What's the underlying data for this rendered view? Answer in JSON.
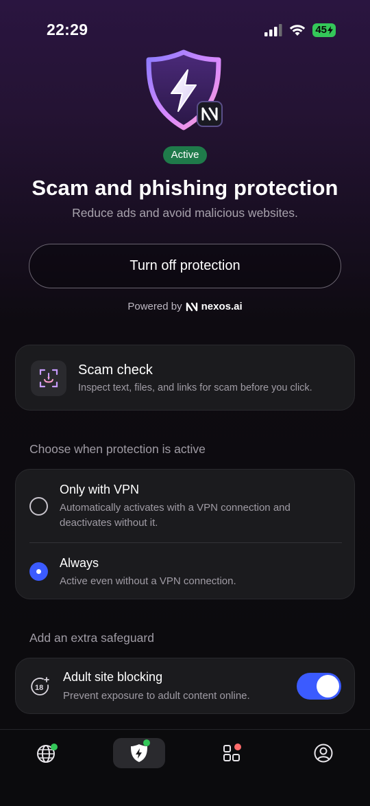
{
  "status_bar": {
    "time": "22:29",
    "battery": "45"
  },
  "hero": {
    "badge": "Active",
    "title": "Scam and phishing protection",
    "subtitle": "Reduce ads and avoid malicious websites.",
    "primary_button": "Turn off protection",
    "powered_by_prefix": "Powered by",
    "powered_by_brand": "nexos.ai"
  },
  "scam_check": {
    "title": "Scam check",
    "description": "Inspect text, files, and links for scam before you click.",
    "icon": "scan-face-icon"
  },
  "protection_mode": {
    "section_label": "Choose when protection is active",
    "options": [
      {
        "title": "Only with VPN",
        "description": "Automatically activates with a VPN connection and deactivates without it.",
        "selected": false
      },
      {
        "title": "Always",
        "description": "Active even without a VPN connection.",
        "selected": true
      }
    ]
  },
  "extra_safeguard": {
    "section_label": "Add an extra safeguard",
    "title": "Adult site blocking",
    "description": "Prevent exposure to adult content online.",
    "icon_text": "18",
    "enabled": true
  },
  "tab_bar": {
    "tabs": [
      {
        "icon": "globe-icon",
        "badge_color": "#34c759",
        "active": false
      },
      {
        "icon": "shield-bolt-icon",
        "badge_color": "#34c759",
        "active": true
      },
      {
        "icon": "apps-grid-icon",
        "badge_color": "#ff6b6b",
        "active": false
      },
      {
        "icon": "profile-icon",
        "badge_color": "",
        "active": false
      }
    ]
  },
  "colors": {
    "accent": "#3b5bff",
    "active_badge": "#1f7a4a",
    "battery": "#34c759"
  }
}
